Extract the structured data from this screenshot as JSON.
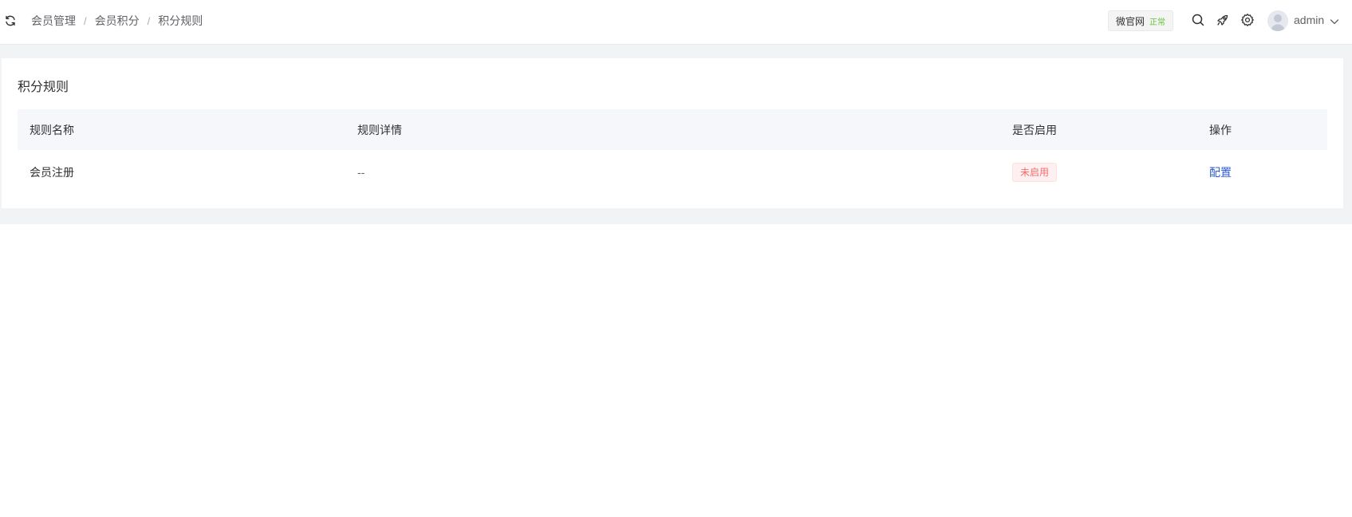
{
  "header": {
    "breadcrumb": [
      "会员管理",
      "会员积分",
      "积分规则"
    ],
    "site": {
      "name": "微官网",
      "status": "正常"
    },
    "user": "admin"
  },
  "card": {
    "title": "积分规则",
    "columns": [
      "规则名称",
      "规则详情",
      "是否启用",
      "操作"
    ],
    "rows": [
      {
        "name": "会员注册",
        "detail": "--",
        "status": "未启用",
        "action": "配置"
      }
    ]
  }
}
